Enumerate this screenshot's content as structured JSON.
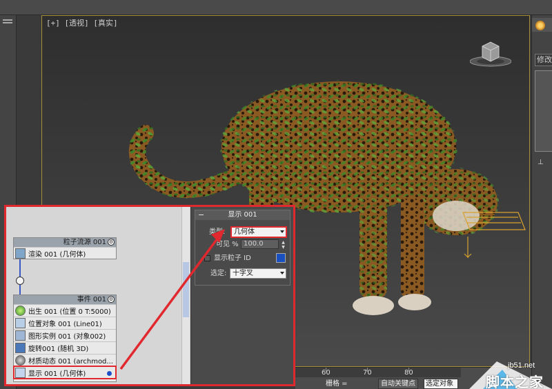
{
  "viewport": {
    "label": "[+] [透视] [真实]"
  },
  "command_panel": {
    "modify_field": "修改器列表"
  },
  "particle_view": {
    "flow_node": {
      "title": "粒子流源 001",
      "ops": [
        {
          "label": "渲染 001 (几何体)"
        }
      ]
    },
    "event_node": {
      "title": "事件 001",
      "ops": [
        {
          "label": "出生 001 (位置 0 T:5000)"
        },
        {
          "label": "位置对象 001 (Line01)"
        },
        {
          "label": "图形实例 001 (对象002)"
        },
        {
          "label": "旋转001 (随机 3D)"
        },
        {
          "label": "材质动态 001 (archmod..."
        },
        {
          "label": "显示 001 (几何体)"
        }
      ]
    }
  },
  "params": {
    "rollout_title": "显示 001",
    "type_label": "类型:",
    "type_value": "几何体",
    "visible_label": "可见 %",
    "visible_value": "100.0",
    "show_id_label": "显示粒子 ID",
    "selected_label": "选定:",
    "selected_value": "十字叉",
    "id_color": "#1a4fbf"
  },
  "bottom_bar": {
    "ticks": [
      "60",
      "70",
      "80"
    ],
    "grid_label": "栅格 =",
    "autokey_label": "自动关键点",
    "select_object_label": "选定对象"
  },
  "watermark": {
    "site": "jb51.net",
    "name": "脚本之家"
  },
  "colors": {
    "highlight": "#e0282e",
    "viewport_border": "#a8903a"
  }
}
